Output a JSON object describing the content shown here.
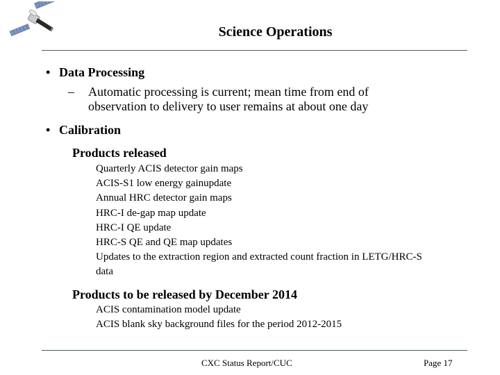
{
  "slide": {
    "logo_icon": "chandra-satellite-icon",
    "title": "Science Operations",
    "sections": [
      {
        "heading": "Data Processing",
        "bullet": "•",
        "subitems": [
          {
            "marker": "–",
            "text": "Automatic processing is current; mean time from end of observation to delivery to user remains at about one day"
          }
        ]
      },
      {
        "heading": "Calibration",
        "bullet": "•",
        "groups": [
          {
            "heading": "Products released",
            "items": [
              "Quarterly ACIS detector gain maps",
              "ACIS-S1 low energy gainupdate",
              "Annual HRC detector gain maps",
              "HRC-I de-gap map update",
              "HRC-I QE update",
              "HRC-S QE and QE map updates",
              "Updates to the extraction region and extracted count fraction in LETG/HRC-S data"
            ]
          },
          {
            "heading": "Products to be released by December 2014",
            "items": [
              "ACIS contamination model update",
              "ACIS blank sky background files for the period 2012-2015"
            ]
          }
        ]
      }
    ],
    "footer": {
      "center": "CXC Status Report/CUC",
      "page": "Page 17"
    }
  },
  "colors": {
    "rule": "#4a5f66",
    "text": "#000000",
    "background": "#ffffff"
  }
}
